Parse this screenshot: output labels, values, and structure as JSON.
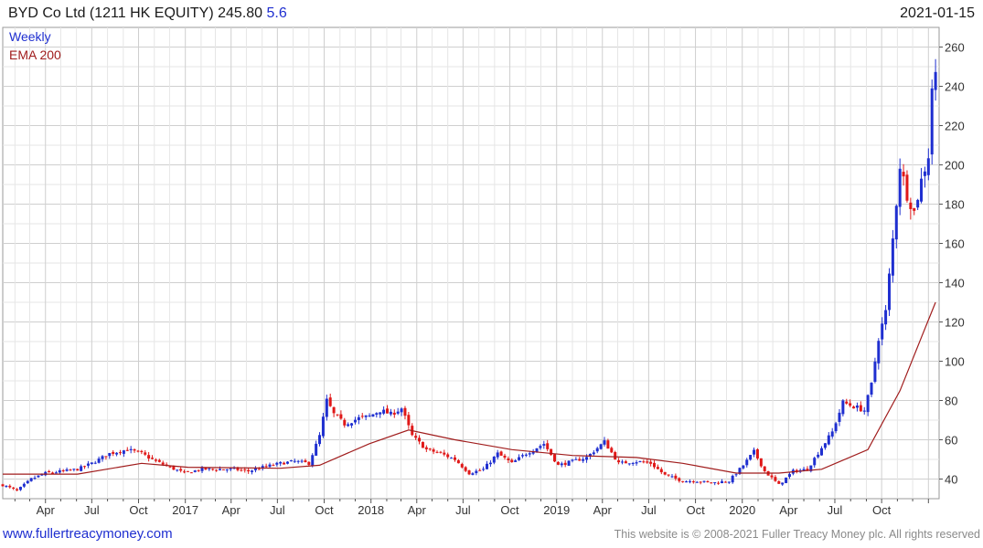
{
  "header": {
    "title": "BYD Co Ltd (1211 HK EQUITY) 245.80",
    "change": "5.6",
    "date": "2021-01-15"
  },
  "footer": {
    "site": "www.fullertreacymoney.com",
    "copyright": "This website is © 2008-2021 Fuller Treacy Money plc. All rights reserved"
  },
  "colors": {
    "up": "#1f2fd0",
    "down": "#e01818",
    "ema": "#a01c1c",
    "grid": "#d9d9d9",
    "axis": "#555555"
  },
  "chart_data": {
    "type": "candlestick",
    "legend": [
      "Weekly",
      "EMA 200"
    ],
    "legend_position": "top-left",
    "y_axis_side": "right",
    "ylim": [
      30,
      270
    ],
    "y_ticks": [
      40,
      60,
      80,
      100,
      120,
      140,
      160,
      180,
      200,
      220,
      240,
      260
    ],
    "x_tick_labels": [
      "Apr",
      "Jul",
      "Oct",
      "2017",
      "Apr",
      "Jul",
      "Oct",
      "2018",
      "Apr",
      "Jul",
      "Oct",
      "2019",
      "Apr",
      "Jul",
      "Oct",
      "2020",
      "Apr",
      "Jul",
      "Oct"
    ],
    "x_range": [
      "2016-01-08",
      "2021-01-22"
    ],
    "grid": true,
    "last_price": 245.8,
    "close_anchors": [
      [
        "2016-01-08",
        37
      ],
      [
        "2016-02-05",
        34
      ],
      [
        "2016-03-04",
        40
      ],
      [
        "2016-04-01",
        43
      ],
      [
        "2016-05-06",
        44
      ],
      [
        "2016-06-03",
        45
      ],
      [
        "2016-07-01",
        48
      ],
      [
        "2016-08-05",
        53
      ],
      [
        "2016-09-09",
        55
      ],
      [
        "2016-10-07",
        53
      ],
      [
        "2016-11-04",
        49
      ],
      [
        "2016-12-02",
        46
      ],
      [
        "2016-12-30",
        43
      ],
      [
        "2017-02-03",
        45
      ],
      [
        "2017-03-03",
        45
      ],
      [
        "2017-04-07",
        45
      ],
      [
        "2017-05-05",
        44
      ],
      [
        "2017-06-02",
        46
      ],
      [
        "2017-07-07",
        48
      ],
      [
        "2017-08-04",
        49
      ],
      [
        "2017-09-01",
        48
      ],
      [
        "2017-09-22",
        62
      ],
      [
        "2017-10-06",
        80
      ],
      [
        "2017-10-20",
        73
      ],
      [
        "2017-11-10",
        68
      ],
      [
        "2017-12-08",
        71
      ],
      [
        "2017-12-29",
        72
      ],
      [
        "2018-01-19",
        75
      ],
      [
        "2018-02-09",
        73
      ],
      [
        "2018-03-02",
        76
      ],
      [
        "2018-03-23",
        62
      ],
      [
        "2018-04-20",
        55
      ],
      [
        "2018-05-18",
        53
      ],
      [
        "2018-06-15",
        50
      ],
      [
        "2018-07-13",
        43
      ],
      [
        "2018-08-10",
        45
      ],
      [
        "2018-09-07",
        53
      ],
      [
        "2018-10-05",
        48
      ],
      [
        "2018-11-02",
        53
      ],
      [
        "2018-12-07",
        58
      ],
      [
        "2019-01-04",
        47
      ],
      [
        "2019-02-01",
        49
      ],
      [
        "2019-03-01",
        51
      ],
      [
        "2019-04-05",
        59
      ],
      [
        "2019-05-03",
        48
      ],
      [
        "2019-06-07",
        49
      ],
      [
        "2019-07-05",
        48
      ],
      [
        "2019-08-02",
        42
      ],
      [
        "2019-09-06",
        39
      ],
      [
        "2019-10-04",
        39
      ],
      [
        "2019-11-01",
        38
      ],
      [
        "2019-12-06",
        39
      ],
      [
        "2020-01-03",
        47
      ],
      [
        "2020-01-24",
        54
      ],
      [
        "2020-02-14",
        44
      ],
      [
        "2020-03-13",
        37
      ],
      [
        "2020-04-10",
        44
      ],
      [
        "2020-05-08",
        45
      ],
      [
        "2020-06-05",
        56
      ],
      [
        "2020-06-26",
        64
      ],
      [
        "2020-07-17",
        79
      ],
      [
        "2020-08-07",
        77
      ],
      [
        "2020-08-28",
        75
      ],
      [
        "2020-09-11",
        88
      ],
      [
        "2020-09-25",
        112
      ],
      [
        "2020-10-09",
        125
      ],
      [
        "2020-10-23",
        162
      ],
      [
        "2020-11-06",
        200
      ],
      [
        "2020-11-20",
        185
      ],
      [
        "2020-12-04",
        176
      ],
      [
        "2020-12-18",
        192
      ],
      [
        "2021-01-01",
        205
      ],
      [
        "2021-01-08",
        240
      ],
      [
        "2021-01-15",
        245.8
      ]
    ],
    "ema_anchors": [
      [
        "2016-01-08",
        42.5
      ],
      [
        "2016-06-03",
        42.5
      ],
      [
        "2016-10-07",
        48
      ],
      [
        "2017-01-06",
        46
      ],
      [
        "2017-07-07",
        45.5
      ],
      [
        "2017-09-22",
        47
      ],
      [
        "2017-12-29",
        58
      ],
      [
        "2018-03-16",
        65
      ],
      [
        "2018-06-15",
        60
      ],
      [
        "2018-10-05",
        55
      ],
      [
        "2019-02-01",
        52
      ],
      [
        "2019-06-07",
        51
      ],
      [
        "2019-09-06",
        48
      ],
      [
        "2019-12-20",
        43
      ],
      [
        "2020-03-13",
        43
      ],
      [
        "2020-06-05",
        45
      ],
      [
        "2020-09-04",
        55
      ],
      [
        "2020-11-06",
        85
      ],
      [
        "2020-12-18",
        112
      ],
      [
        "2021-01-15",
        130
      ]
    ]
  }
}
